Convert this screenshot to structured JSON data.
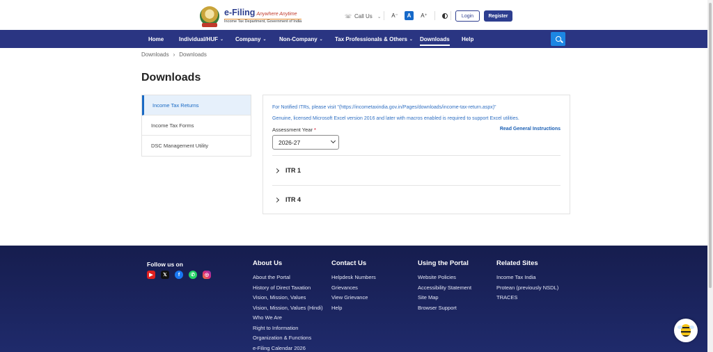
{
  "header": {
    "logo_title": "e-Filing",
    "logo_tagline": "Anywhere Anytime",
    "logo_subtitle": "Income Tax Department, Government of India",
    "call_us": "Call Us",
    "font_small": "A⁻",
    "font_normal": "A",
    "font_large": "A⁺",
    "login": "Login",
    "register": "Register"
  },
  "nav": {
    "items": [
      {
        "label": "Home"
      },
      {
        "label": "Individual/HUF"
      },
      {
        "label": "Company"
      },
      {
        "label": "Non-Company"
      },
      {
        "label": "Tax Professionals & Others"
      },
      {
        "label": "Downloads"
      },
      {
        "label": "Help"
      }
    ]
  },
  "breadcrumb": {
    "root": "Downloads",
    "sep": "›",
    "current": "Downloads"
  },
  "page_title": "Downloads",
  "sidebar": {
    "items": [
      {
        "label": "Income Tax Returns"
      },
      {
        "label": "Income Tax Forms"
      },
      {
        "label": "DSC Management Utility"
      }
    ]
  },
  "main": {
    "notice1": "For Notified ITRs, please visit \"(https://incometaxindia.gov.in/Pages/downloads/income-tax-return.aspx)\"",
    "notice2": "Genuine, licensed Microsoft Excel version 2016 and later with macros enabled is required to support Excel utilities.",
    "ay_label": "Assessment Year",
    "ay_required": "*",
    "ay_value": "2026-27",
    "read_instructions": "Read General Instructions",
    "itr_rows": [
      {
        "label": "ITR 1"
      },
      {
        "label": "ITR 4"
      }
    ]
  },
  "footer": {
    "follow_us": "Follow us on",
    "about": {
      "heading": "About Us",
      "links": [
        "About the Portal",
        "History of Direct Taxation",
        "Vision, Mission, Values",
        "Vision, Mission, Values (Hindi)",
        "Who We Are",
        "Right to Information",
        "Organization & Functions",
        "e-Filing Calendar 2026"
      ]
    },
    "contact": {
      "heading": "Contact Us",
      "links": [
        "Helpdesk Numbers",
        "Grievances",
        "View Grievance",
        "Help"
      ]
    },
    "using": {
      "heading": "Using the Portal",
      "links": [
        "Website Policies",
        "Accessibility Statement",
        "Site Map",
        "Browser Support"
      ]
    },
    "related": {
      "heading": "Related Sites",
      "links": [
        "Income Tax India",
        "Protean (previously NSDL)",
        "TRACES"
      ]
    }
  },
  "colors": {
    "nav_bg": "#2a3582",
    "footer_bg": "#1f2a6b",
    "accent": "#1a6ac4",
    "register_bg": "#2d3e8f"
  }
}
